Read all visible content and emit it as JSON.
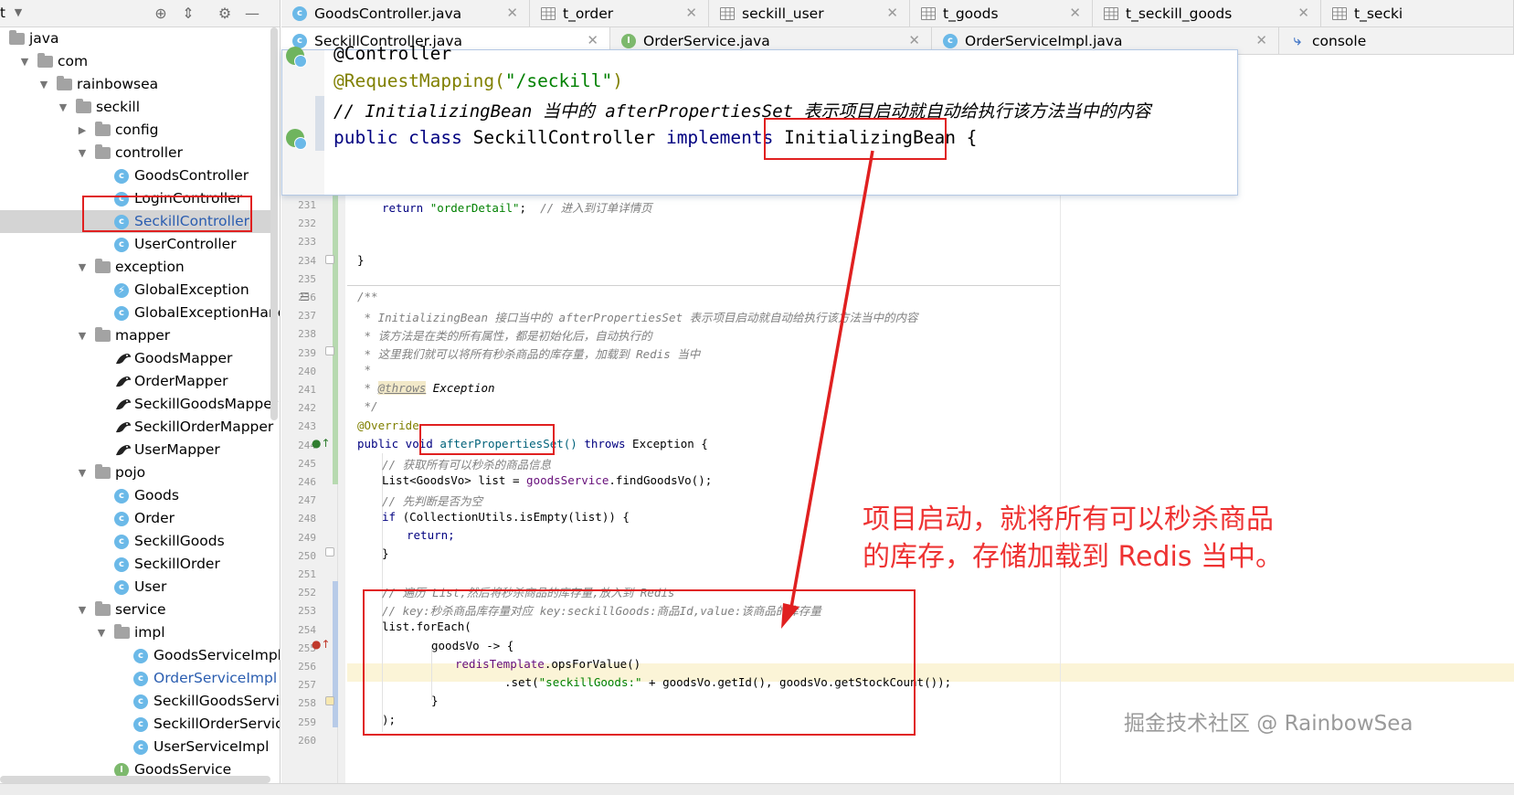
{
  "project": {
    "title": "t",
    "tree": [
      {
        "label": "java",
        "kind": "folder",
        "arrow": "",
        "depth": 0
      },
      {
        "label": "com",
        "kind": "folder",
        "arrow": "▼",
        "depth": 1
      },
      {
        "label": "rainbowsea",
        "kind": "folder",
        "arrow": "▼",
        "depth": 2
      },
      {
        "label": "seckill",
        "kind": "folder",
        "arrow": "▼",
        "depth": 3
      },
      {
        "label": "config",
        "kind": "folder",
        "arrow": "▶",
        "depth": 4
      },
      {
        "label": "controller",
        "kind": "folder",
        "arrow": "▼",
        "depth": 4
      },
      {
        "label": "GoodsController",
        "kind": "class",
        "arrow": "",
        "depth": 5
      },
      {
        "label": "LoginController",
        "kind": "class",
        "arrow": "",
        "depth": 5
      },
      {
        "label": "SeckillController",
        "kind": "class",
        "arrow": "",
        "depth": 5,
        "selected": true
      },
      {
        "label": "UserController",
        "kind": "class",
        "arrow": "",
        "depth": 5
      },
      {
        "label": "exception",
        "kind": "folder",
        "arrow": "▼",
        "depth": 4
      },
      {
        "label": "GlobalException",
        "kind": "exception",
        "arrow": "",
        "depth": 5
      },
      {
        "label": "GlobalExceptionHandl",
        "kind": "class",
        "arrow": "",
        "depth": 5
      },
      {
        "label": "mapper",
        "kind": "folder",
        "arrow": "▼",
        "depth": 4
      },
      {
        "label": "GoodsMapper",
        "kind": "mapper",
        "arrow": "",
        "depth": 5
      },
      {
        "label": "OrderMapper",
        "kind": "mapper",
        "arrow": "",
        "depth": 5
      },
      {
        "label": "SeckillGoodsMapper",
        "kind": "mapper",
        "arrow": "",
        "depth": 5
      },
      {
        "label": "SeckillOrderMapper",
        "kind": "mapper",
        "arrow": "",
        "depth": 5
      },
      {
        "label": "UserMapper",
        "kind": "mapper",
        "arrow": "",
        "depth": 5
      },
      {
        "label": "pojo",
        "kind": "folder",
        "arrow": "▼",
        "depth": 4
      },
      {
        "label": "Goods",
        "kind": "class",
        "arrow": "",
        "depth": 5
      },
      {
        "label": "Order",
        "kind": "class",
        "arrow": "",
        "depth": 5
      },
      {
        "label": "SeckillGoods",
        "kind": "class",
        "arrow": "",
        "depth": 5
      },
      {
        "label": "SeckillOrder",
        "kind": "class",
        "arrow": "",
        "depth": 5
      },
      {
        "label": "User",
        "kind": "class",
        "arrow": "",
        "depth": 5
      },
      {
        "label": "service",
        "kind": "folder",
        "arrow": "▼",
        "depth": 4
      },
      {
        "label": "impl",
        "kind": "folder",
        "arrow": "▼",
        "depth": 5
      },
      {
        "label": "GoodsServiceImpl",
        "kind": "class",
        "arrow": "",
        "depth": 6
      },
      {
        "label": "OrderServiceImpl",
        "kind": "class",
        "arrow": "",
        "depth": 6,
        "blue": true
      },
      {
        "label": "SeckillGoodsServic",
        "kind": "class",
        "arrow": "",
        "depth": 6
      },
      {
        "label": "SeckillOrderService",
        "kind": "class",
        "arrow": "",
        "depth": 6
      },
      {
        "label": "UserServiceImpl",
        "kind": "class",
        "arrow": "",
        "depth": 6
      },
      {
        "label": "GoodsService",
        "kind": "interface",
        "arrow": "",
        "depth": 5
      }
    ]
  },
  "tabs_row1": [
    {
      "label": "GoodsController.java",
      "icon": "class"
    },
    {
      "label": "t_order",
      "icon": "table"
    },
    {
      "label": "seckill_user",
      "icon": "table"
    },
    {
      "label": "t_goods",
      "icon": "table"
    },
    {
      "label": "t_seckill_goods",
      "icon": "table"
    },
    {
      "label": "t_secki",
      "icon": "table"
    }
  ],
  "tabs_row2": [
    {
      "label": "SeckillController.java",
      "icon": "class",
      "active": true
    },
    {
      "label": "OrderService.java",
      "icon": "interface"
    },
    {
      "label": "OrderServiceImpl.java",
      "icon": "class"
    },
    {
      "label": "console",
      "icon": "console"
    }
  ],
  "popup": {
    "line1": "@Controller",
    "line2_ann": "@RequestMapping(",
    "line2_str": "\"/seckill\"",
    "line2_end": ")",
    "line3": "// InitializingBean 当中的 afterPropertiesSet 表示项目启动就自动给执行该方法当中的内容",
    "line4_kw1": "public class ",
    "line4_name": "SeckillController ",
    "line4_kw2": "implements ",
    "line4_iface": "InitializingBean",
    "line4_end": " {"
  },
  "code": {
    "line_numbers": [
      "231",
      "232",
      "233",
      "234",
      "235",
      "236",
      "237",
      "238",
      "239",
      "240",
      "241",
      "242",
      "243",
      "244",
      "245",
      "246",
      "247",
      "248",
      "249",
      "250",
      "251",
      "252",
      "253",
      "254",
      "255",
      "256",
      "257",
      "258",
      "259",
      "260"
    ],
    "l231_kw": "return ",
    "l231_str": "\"orderDetail\"",
    "l231_end": ";  ",
    "l231_cmt": "// 进入到订单详情页",
    "l234": "}",
    "l236": "/**",
    "l237": " * InitializingBean 接口当中的 afterPropertiesSet 表示项目启动就自动给执行该方法当中的内容",
    "l238": " * 该方法是在类的所有属性，都是初始化后，自动执行的",
    "l239": " * 这里我们就可以将所有秒杀商品的库存量，加载到 Redis 当中",
    "l240": " *",
    "l241_pre": " * ",
    "l241_tag": "@throws",
    "l241_post": " Exception",
    "l242": " */",
    "l243": "@Override",
    "l244_kw": "public void ",
    "l244_meth": "afterPropertiesSet()",
    "l244_throws": " throws ",
    "l244_ex": "Exception {",
    "l245": "// 获取所有可以秒杀的商品信息",
    "l246_pre": "List<GoodsVo> list = ",
    "l246_fld": "goodsService",
    "l246_post": ".findGoodsVo();",
    "l247": "// 先判断是否为空",
    "l248_kw": "if ",
    "l248_rest": "(CollectionUtils.isEmpty(list)) {",
    "l249": "return;",
    "l250": "}",
    "l252": "// 遍历 List,然后将秒杀商品的库存量,放入到 Redis",
    "l253": "// key:秒杀商品库存量对应 key:seckillGoods:商品Id,value:该商品的库存量",
    "l254": "list.forEach(",
    "l255": "goodsVo -> {",
    "l256_fld": "redisTemplate",
    "l256_post": ".opsForValue()",
    "l257_pre": ".set(",
    "l257_str": "\"seckillGoods:\"",
    "l257_post": " + goodsVo.getId(), goodsVo.getStockCount());",
    "l258": "}",
    "l259": ");"
  },
  "annotation": {
    "text": "项目启动，就将所有可以秒杀商品的库存，存储加载到 Redis 当中。",
    "color": "#e33333"
  },
  "watermark": "掘金技术社区 @ RainbowSea"
}
